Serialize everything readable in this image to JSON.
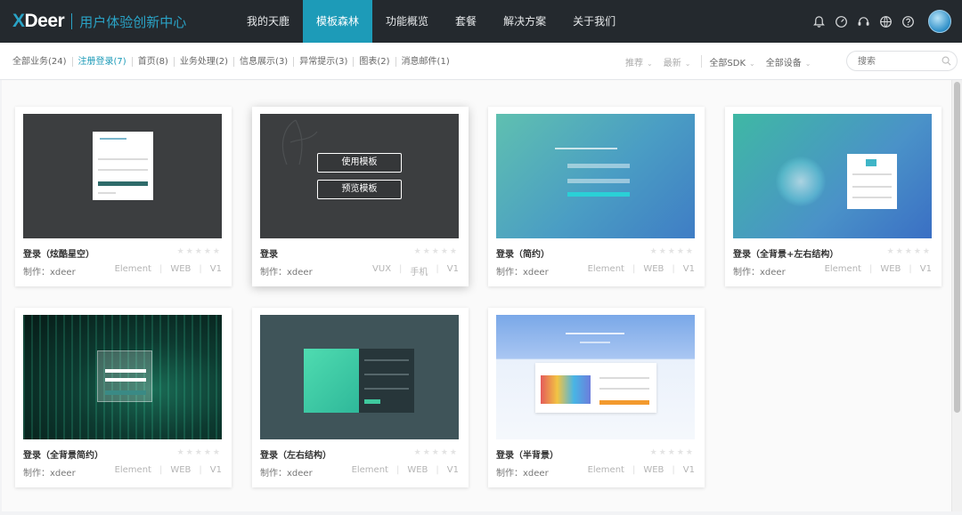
{
  "brand": {
    "logo": "Deer",
    "logo_prefix": "X",
    "subtitle": "用户体验创新中心"
  },
  "nav": [
    {
      "label": "我的天鹿",
      "active": false
    },
    {
      "label": "模板森林",
      "active": true
    },
    {
      "label": "功能概览",
      "active": false
    },
    {
      "label": "套餐",
      "active": false
    },
    {
      "label": "解决方案",
      "active": false
    },
    {
      "label": "关于我们",
      "active": false
    }
  ],
  "header_icons": [
    "bell-icon",
    "gauge-icon",
    "headset-icon",
    "globe-icon",
    "help-icon"
  ],
  "categories": [
    {
      "label": "全部业务(24)",
      "active": false
    },
    {
      "label": "注册登录(7)",
      "active": true
    },
    {
      "label": "首页(8)",
      "active": false
    },
    {
      "label": "业务处理(2)",
      "active": false
    },
    {
      "label": "信息展示(3)",
      "active": false
    },
    {
      "label": "异常提示(3)",
      "active": false
    },
    {
      "label": "图表(2)",
      "active": false
    },
    {
      "label": "消息邮件(1)",
      "active": false
    }
  ],
  "sorts": {
    "recommend": "推荐",
    "latest": "最新",
    "sdk": "全部SDK",
    "device": "全部设备"
  },
  "search": {
    "placeholder": "搜索"
  },
  "overlay": {
    "use": "使用模板",
    "preview": "预览模板"
  },
  "cards": [
    {
      "title": "登录（炫酷星空）",
      "author": "制作：xdeer",
      "tags": [
        "Element",
        "WEB",
        "V1"
      ]
    },
    {
      "title": "登录",
      "author": "制作：xdeer",
      "tags": [
        "VUX",
        "手机",
        "V1"
      ]
    },
    {
      "title": "登录（简约）",
      "author": "制作：xdeer",
      "tags": [
        "Element",
        "WEB",
        "V1"
      ]
    },
    {
      "title": "登录（全背景+左右结构）",
      "author": "制作：xdeer",
      "tags": [
        "Element",
        "WEB",
        "V1"
      ]
    },
    {
      "title": "登录（全背景简约）",
      "author": "制作：xdeer",
      "tags": [
        "Element",
        "WEB",
        "V1"
      ]
    },
    {
      "title": "登录（左右结构）",
      "author": "制作：xdeer",
      "tags": [
        "Element",
        "WEB",
        "V1"
      ]
    },
    {
      "title": "登录（半背景）",
      "author": "制作：xdeer",
      "tags": [
        "Element",
        "WEB",
        "V1"
      ]
    }
  ],
  "stars": "★★★★★",
  "colors": {
    "accent": "#1d9bb8",
    "topbar": "#24292e"
  }
}
